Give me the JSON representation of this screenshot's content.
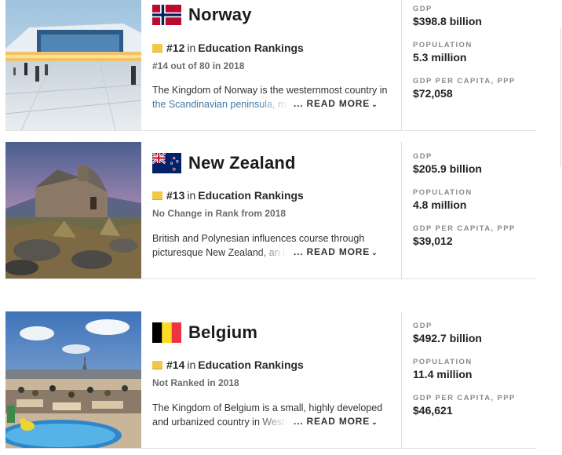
{
  "cards": [
    {
      "country": "Norway",
      "rank_num": "#12",
      "rank_in": "in",
      "rank_label": "Education Rankings",
      "rank_sub": "#14 out of 80 in 2018",
      "desc_line1": "The Kingdom of Norway is the westernmost country in",
      "desc_line2_link": "the Scandinavian peninsula,",
      "desc_line2_rest": " made",
      "read_more": "... READ MORE",
      "stats": [
        {
          "label": "GDP",
          "value": "$398.8 billion"
        },
        {
          "label": "POPULATION",
          "value": "5.3 million"
        },
        {
          "label": "GDP PER CAPITA, PPP",
          "value": "$72,058"
        }
      ]
    },
    {
      "country": "New Zealand",
      "rank_num": "#13",
      "rank_in": "in",
      "rank_label": "Education Rankings",
      "rank_sub": "No Change in Rank from 2018",
      "desc_line1": "British and Polynesian influences course through",
      "desc_line2_link": "",
      "desc_line2_rest": "picturesque New Zealand, an islan",
      "read_more": "... READ MORE",
      "stats": [
        {
          "label": "GDP",
          "value": "$205.9 billion"
        },
        {
          "label": "POPULATION",
          "value": "4.8 million"
        },
        {
          "label": "GDP PER CAPITA, PPP",
          "value": "$39,012"
        }
      ]
    },
    {
      "country": "Belgium",
      "rank_num": "#14",
      "rank_in": "in",
      "rank_label": "Education Rankings",
      "rank_sub": "Not Ranked in 2018",
      "desc_line1": "The Kingdom of Belgium is a small, highly developed",
      "desc_line2_link": "",
      "desc_line2_rest": "and urbanized country in Western",
      "read_more": "... READ MORE",
      "stats": [
        {
          "label": "GDP",
          "value": "$492.7 billion"
        },
        {
          "label": "POPULATION",
          "value": "11.4 million"
        },
        {
          "label": "GDP PER CAPITA, PPP",
          "value": "$46,621"
        }
      ]
    }
  ],
  "colors": {
    "medal": "#f2c744",
    "link": "#3e7aa8",
    "norway_red": "#ba0c2f",
    "norway_blue": "#00205b",
    "nz_blue": "#012169",
    "belgium_black": "#000000",
    "belgium_yellow": "#fdda24",
    "belgium_red": "#ef3340"
  }
}
